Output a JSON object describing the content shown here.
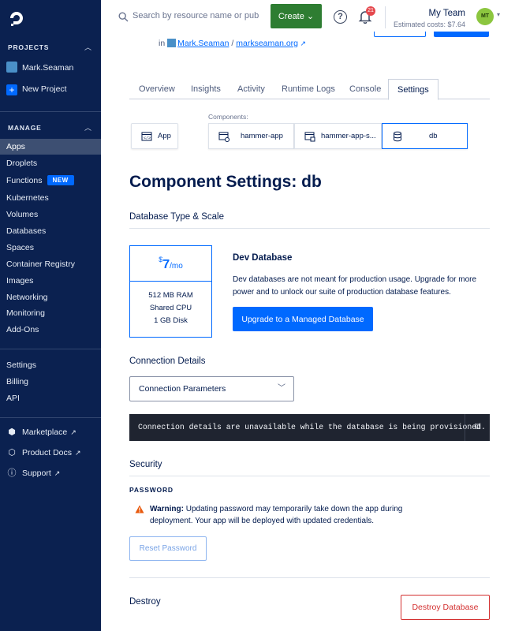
{
  "sidebar": {
    "projects_heading": "PROJECTS",
    "project_name": "Mark.Seaman",
    "new_project": "New Project",
    "manage_heading": "MANAGE",
    "manage_items": [
      "Apps",
      "Droplets",
      "Functions",
      "Kubernetes",
      "Volumes",
      "Databases",
      "Spaces",
      "Container Registry",
      "Images",
      "Networking",
      "Monitoring",
      "Add-Ons"
    ],
    "new_badge": "NEW",
    "account_items": [
      "Settings",
      "Billing",
      "API"
    ],
    "links": [
      "Marketplace",
      "Product Docs",
      "Support"
    ]
  },
  "topbar": {
    "search_placeholder": "Search by resource name or public IP",
    "create_label": "Create",
    "help": "?",
    "notifications_count": "21",
    "team_name": "My Team",
    "estimated_costs": "Estimated costs: $7.64",
    "avatar_initials": "MT"
  },
  "breadcrumb": {
    "prefix": "in",
    "project": "Mark.Seaman",
    "separator": "/",
    "site": "markseaman.org"
  },
  "tabs": [
    "Overview",
    "Insights",
    "Activity",
    "Runtime Logs",
    "Console",
    "Settings"
  ],
  "components": {
    "label": "Components:",
    "app": "App",
    "items": [
      "hammer-app",
      "hammer-app-s...",
      "db"
    ]
  },
  "page_title": "Component Settings: db",
  "db_section": {
    "heading": "Database Type & Scale",
    "price_currency": "$",
    "price_value": "7",
    "price_period": "/mo",
    "specs": [
      "512 MB RAM",
      "Shared CPU",
      "1 GB Disk"
    ],
    "title": "Dev Database",
    "description": "Dev databases are not meant for production usage. Upgrade for more power and to unlock our suite of production database features.",
    "upgrade_label": "Upgrade to a Managed Database"
  },
  "connection": {
    "heading": "Connection Details",
    "select_value": "Connection Parameters",
    "message": "Connection details are unavailable while the database is being provisioned."
  },
  "security": {
    "heading": "Security",
    "password_label": "PASSWORD",
    "warning_bold": "Warning:",
    "warning_text": "Updating password may temporarily take down the app during deployment. Your app will be deployed with updated credentials.",
    "reset_label": "Reset Password"
  },
  "destroy": {
    "heading": "Destroy",
    "button_label": "Destroy Database"
  },
  "colors": {
    "sidebar_bg": "#0b2150",
    "primary": "#0069ff",
    "create_green": "#2e7d32",
    "danger": "#d32f2f"
  }
}
